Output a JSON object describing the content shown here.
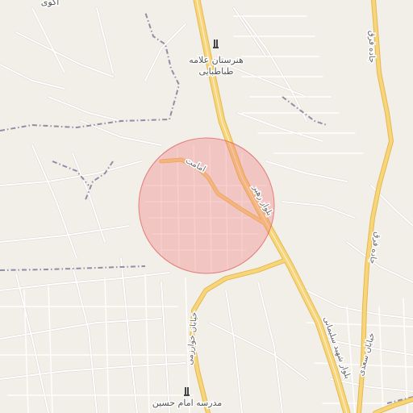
{
  "map": {
    "colors": {
      "land": "#f2efe9",
      "street": "#ffffff",
      "street_casing": "#d9d5cf",
      "major_road": "#f7d57a",
      "major_road_casing": "#e6b84f",
      "boundary": "#8e8fa6",
      "circle_fill": "#f08080",
      "circle_stroke": "#e05555"
    },
    "labels": {
      "top_left": "اکوی",
      "poi_school_1_line1": "هنرستان علامه",
      "poi_school_1_line2": "طباطبایی",
      "poi_school_2": "مدرسه امام حسین",
      "road_east_top": "جاده فرق",
      "road_east_mid": "جاده فرق",
      "road_imamat": "امامت",
      "road_rahbar": "بلوار رهبر",
      "road_shahid_soleimani": "بلوار شهید سلیمانی",
      "road_kharazmi": "خیابان خوارزمی",
      "road_sadi": "خیابان سعدی"
    },
    "icons": {
      "poi_1": "school-icon",
      "poi_2": "school-icon"
    }
  }
}
